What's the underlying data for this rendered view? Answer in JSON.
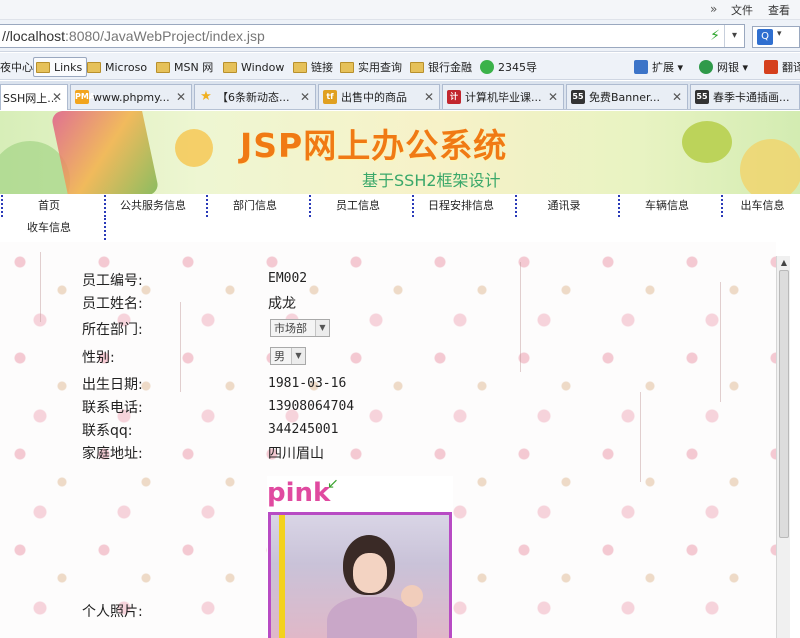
{
  "menu": {
    "chevron": "»",
    "file": "文件",
    "view": "查看"
  },
  "address": {
    "scheme_host": "//localhost",
    "rest": ":8080/JavaWebProject/index.jsp",
    "go_glyph": "⚡",
    "dropdown_glyph": "▾"
  },
  "favorites": [
    {
      "label": "夜中心",
      "icon": "none"
    },
    {
      "label": "Links",
      "icon": "folder"
    },
    {
      "label": "Microso",
      "icon": "folder"
    },
    {
      "label": "MSN 网",
      "icon": "folder"
    },
    {
      "label": "Window",
      "icon": "folder"
    },
    {
      "label": "链接",
      "icon": "folder"
    },
    {
      "label": "实用查询",
      "icon": "folder"
    },
    {
      "label": "银行金融",
      "icon": "folder"
    },
    {
      "label": "2345导",
      "icon": "2345-icon"
    }
  ],
  "extensions": {
    "expand": "扩展",
    "netbank": "网银",
    "translate": "翻译"
  },
  "tabs": [
    {
      "label": "SSH网上...",
      "icon_text": "",
      "icon_color": "#ffffff"
    },
    {
      "label": "www.phpmy...",
      "icon_text": "PMA",
      "icon_color": "#f2a51e"
    },
    {
      "label": "【6条新动态...",
      "icon_text": "★",
      "icon_color": "#f0b020"
    },
    {
      "label": "出售中的商品",
      "icon_text": "tf",
      "icon_color": "#e0a020"
    },
    {
      "label": "计算机毕业课...",
      "icon_text": "计",
      "icon_color": "#c2262e"
    },
    {
      "label": "免费Banner...",
      "icon_text": "55",
      "icon_color": "#333333"
    },
    {
      "label": "春季卡通插画...",
      "icon_text": "55",
      "icon_color": "#333333"
    }
  ],
  "banner": {
    "title": "JSP网上办公系统",
    "subtitle": "基于SSH2框架设计"
  },
  "nav": [
    "首页",
    "公共服务信息",
    "部门信息",
    "员工信息",
    "日程安排信息",
    "通讯录",
    "车辆信息",
    "出车信息",
    "收车信息"
  ],
  "employee": {
    "fields": [
      {
        "label": "员工编号:",
        "value": "EM002"
      },
      {
        "label": "员工姓名:",
        "value": "成龙"
      },
      {
        "label": "所在部门:",
        "value": "市场部"
      },
      {
        "label": "性别:",
        "value": "男"
      },
      {
        "label": "出生日期:",
        "value": "1981-03-16"
      },
      {
        "label": "联系电话:",
        "value": "13908064704"
      },
      {
        "label": "联系qq:",
        "value": "344245001"
      },
      {
        "label": "家庭地址:",
        "value": "四川眉山"
      }
    ],
    "photo_label": "个人照片:",
    "photo_caption": "pink"
  },
  "colors": {
    "banner_title": "#f07a14",
    "banner_subtitle": "#3aa86a",
    "nav_separator": "#2a3ab8"
  }
}
